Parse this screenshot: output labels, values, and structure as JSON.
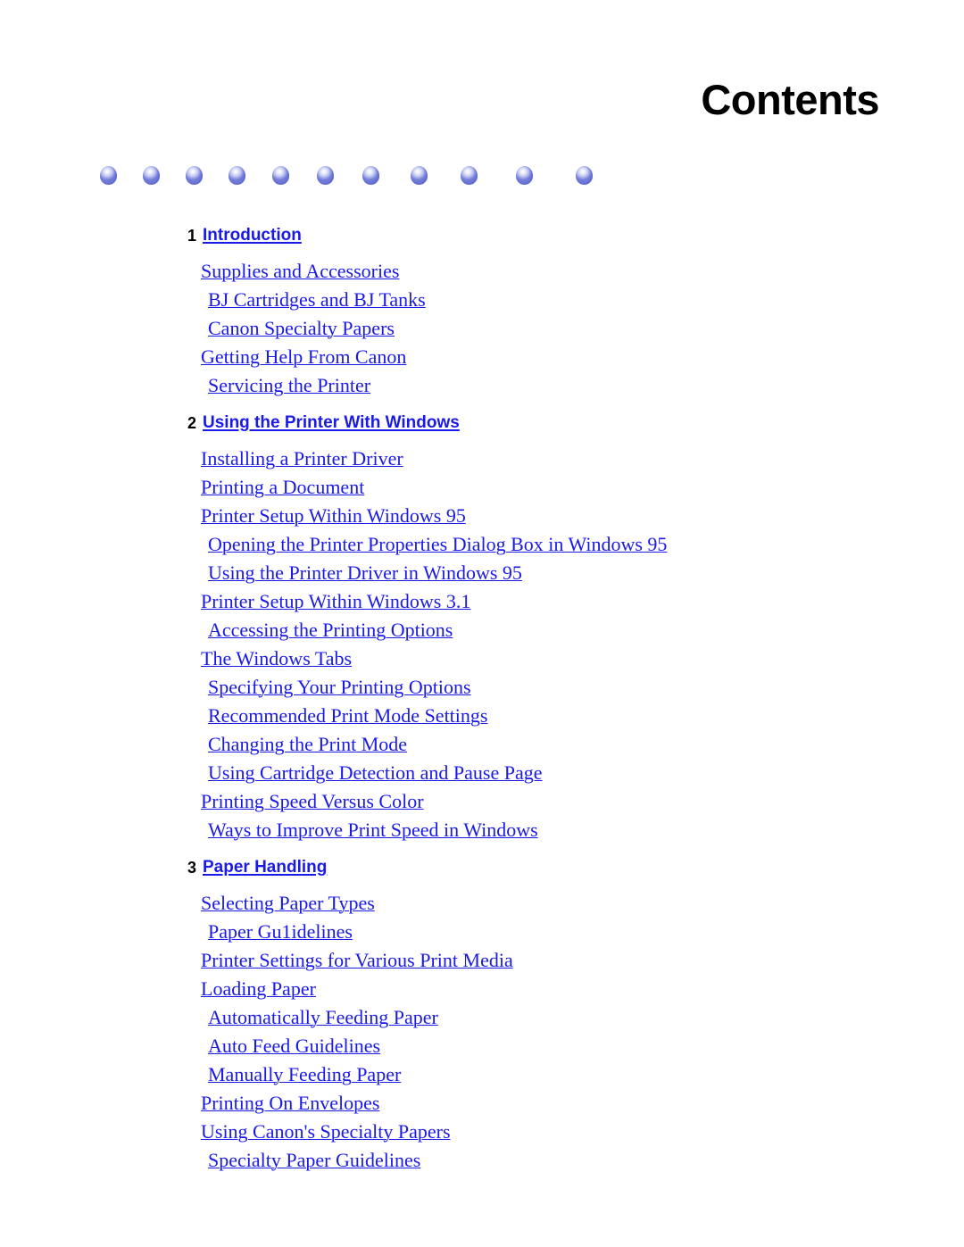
{
  "document": {
    "title": "Contents",
    "link_color": "#1a1ae6",
    "chapter_number_color": "#000000",
    "title_color": "#000000",
    "background_color": "#ffffff",
    "sphere_color": "#8f98e2"
  },
  "decoration": {
    "name": "blue-sphere-rule",
    "count": 11,
    "positions": [
      112,
      160,
      208,
      256,
      305,
      355,
      406,
      460,
      516,
      578,
      645
    ]
  },
  "toc": {
    "chapters": [
      {
        "number": "1",
        "title": "Introduction",
        "entries": [
          {
            "label": "Supplies and Accessories",
            "level": 1
          },
          {
            "label": "BJ Cartridges and BJ Tanks",
            "level": 2
          },
          {
            "label": "Canon Specialty Papers",
            "level": 2
          },
          {
            "label": "Getting Help From Canon",
            "level": 1
          },
          {
            "label": "Servicing the Printer",
            "level": 2
          }
        ]
      },
      {
        "number": "2",
        "title": "Using the Printer With Windows",
        "entries": [
          {
            "label": "Installing a Printer Driver",
            "level": 1
          },
          {
            "label": "Printing a Document",
            "level": 1
          },
          {
            "label": "Printer Setup Within Windows 95",
            "level": 1
          },
          {
            "label": "Opening the Printer Properties Dialog Box in Windows 95",
            "level": 2
          },
          {
            "label": "Using the Printer Driver in Windows 95",
            "level": 2
          },
          {
            "label": "Printer Setup Within Windows 3.1",
            "level": 1
          },
          {
            "label": "Accessing the Printing Options",
            "level": 2
          },
          {
            "label": "The Windows Tabs",
            "level": 1
          },
          {
            "label": "Specifying Your Printing Options",
            "level": 2
          },
          {
            "label": "Recommended Print Mode Settings",
            "level": 2
          },
          {
            "label": "Changing the Print Mode",
            "level": 2
          },
          {
            "label": "Using Cartridge Detection and Pause Page",
            "level": 2
          },
          {
            "label": "Printing Speed Versus Color",
            "level": 1
          },
          {
            "label": "Ways to Improve Print Speed in Windows",
            "level": 2
          }
        ]
      },
      {
        "number": "3",
        "title": "Paper Handling",
        "entries": [
          {
            "label": "Selecting Paper Types",
            "level": 1
          },
          {
            "label": "Paper Gu1idelines",
            "level": 2
          },
          {
            "label": "Printer Settings for Various Print Media",
            "level": 1
          },
          {
            "label": "Loading Paper",
            "level": 1
          },
          {
            "label": "Automatically Feeding Paper",
            "level": 2
          },
          {
            "label": "Auto Feed Guidelines",
            "level": 2
          },
          {
            "label": "Manually Feeding Paper",
            "level": 2
          },
          {
            "label": "Printing On Envelopes",
            "level": 1
          },
          {
            "label": "Using Canon's Specialty Papers",
            "level": 1
          },
          {
            "label": "Specialty Paper Guidelines",
            "level": 2
          }
        ]
      }
    ]
  }
}
